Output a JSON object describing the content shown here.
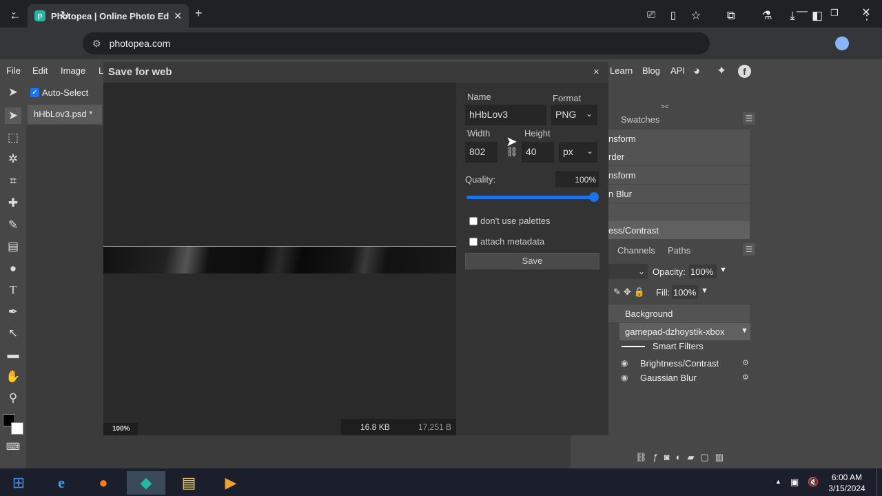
{
  "browser": {
    "tab_title": "Photopea | Online Photo Editor",
    "url": "photopea.com",
    "tab_close": "✕",
    "new_tab": "+"
  },
  "app": {
    "menu": [
      "File",
      "Edit",
      "Image",
      "L"
    ],
    "menu_right": [
      "Learn",
      "Blog",
      "API"
    ],
    "auto_select_label": "Auto-Select",
    "doc_tab": "hHbLov3.psd *"
  },
  "panels": {
    "swatches_tab": "Swatches",
    "history_items": [
      "nsform",
      "rder",
      "nsform",
      "n Blur",
      "",
      "ess/Contrast"
    ],
    "layers_tabs": [
      "Channels",
      "Paths"
    ],
    "opacity_label": "Opacity:",
    "opacity_value": "100%",
    "fill_label": "Fill:",
    "fill_value": "100%",
    "layers": [
      "Background",
      "gamepad-dzhoystik-xbox",
      "Smart Filters",
      "Brightness/Contrast",
      "Gaussian Blur"
    ]
  },
  "dialog": {
    "title": "Save for web",
    "close": "×",
    "name_label": "Name",
    "name_value": "hHbLov3",
    "format_label": "Format",
    "format_value": "PNG",
    "width_label": "Width",
    "width_value": "802",
    "height_label": "Height",
    "height_value": "40",
    "unit_value": "px",
    "quality_label": "Quality:",
    "quality_value": "100%",
    "quality_fraction": 1.0,
    "palettes_label": "don't use palettes",
    "metadata_label": "attach metadata",
    "save_label": "Save",
    "zoom": "100%",
    "size_kb": "16.8 KB",
    "size_bytes": "17,251 B"
  },
  "taskbar": {
    "time": "6:00 AM",
    "date": "3/15/2024"
  },
  "colors": {
    "accent": "#1a73e8",
    "photopea_teal": "#1fb9a6"
  }
}
